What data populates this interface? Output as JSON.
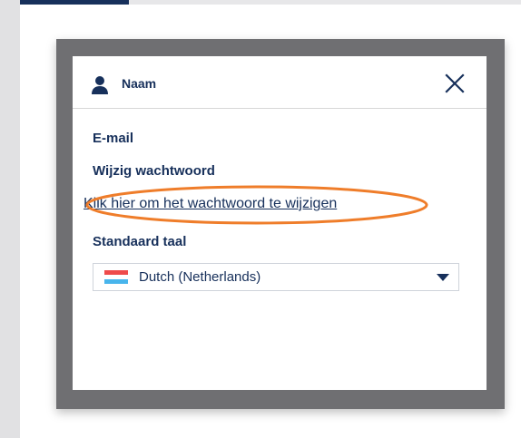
{
  "user": {
    "name": "Naam"
  },
  "fields": {
    "email_label": "E-mail",
    "password_label": "Wijzig wachtwoord",
    "password_link": "Klik hier om het wachtwoord te wijzigen",
    "language_label": "Standaard taal",
    "language_value": "Dutch (Netherlands)"
  },
  "icons": {
    "user": "user-icon",
    "close": "close-icon",
    "flag": "netherlands-flag-icon",
    "dropdown": "chevron-down-icon"
  },
  "colors": {
    "primary_text": "#17305b",
    "dialog_backdrop": "#6f6f72",
    "highlight": "#ef7d2a",
    "flag_red": "#ef4b4b",
    "flag_blue": "#48b5ec"
  }
}
